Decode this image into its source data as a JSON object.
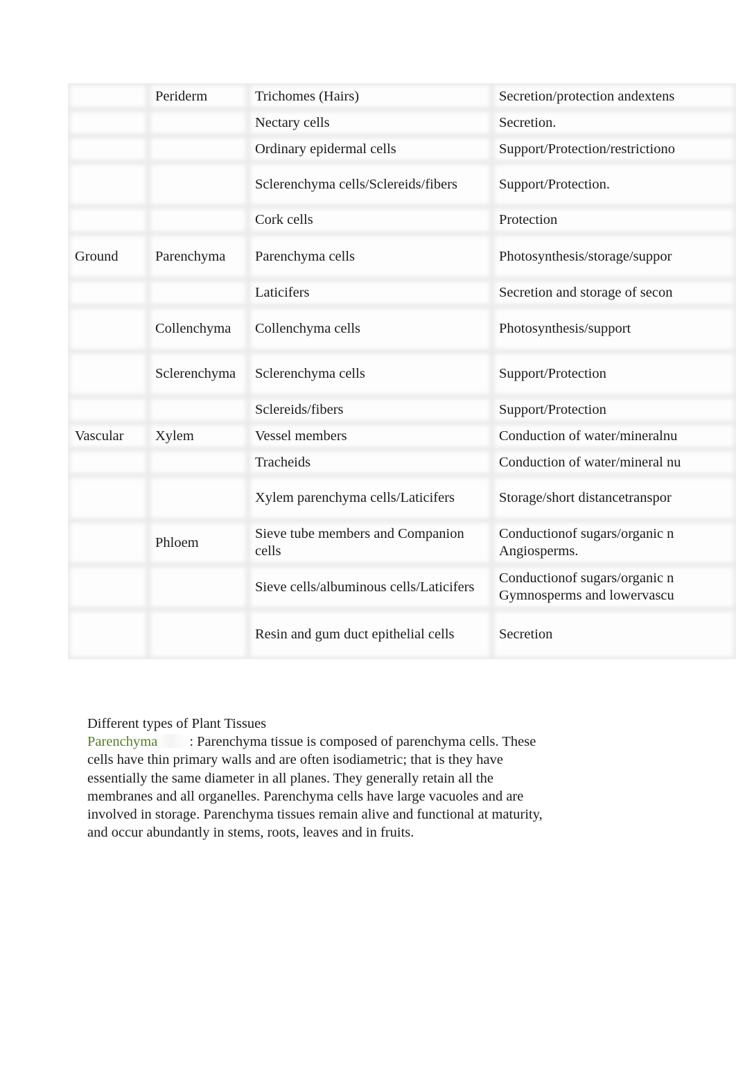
{
  "table": {
    "rows": [
      {
        "system": "",
        "tissue": "Periderm",
        "cell_type": "Trichomes (Hairs)",
        "function": "Secretion/protection andextens",
        "height": 38
      },
      {
        "system": "",
        "tissue": "",
        "cell_type": "Nectary cells",
        "function": "Secretion.",
        "height": 38
      },
      {
        "system": "",
        "tissue": "",
        "cell_type": "Ordinary epidermal cells",
        "function": "Support/Protection/restrictiono",
        "height": 38
      },
      {
        "system": "",
        "tissue": "",
        "cell_type": "Sclerenchyma cells/Sclereids/fibers",
        "function": "Support/Protection.",
        "height": 64
      },
      {
        "system": "",
        "tissue": "",
        "cell_type": "Cork cells",
        "function": "Protection",
        "height": 39
      },
      {
        "system": "Ground",
        "tissue": "Parenchyma",
        "cell_type": "Parenchyma cells",
        "function": "Photosynthesis/storage/suppor",
        "height": 66
      },
      {
        "system": "",
        "tissue": "",
        "cell_type": "Laticifers",
        "function": "Secretion and storage of secon",
        "height": 39
      },
      {
        "system": "",
        "tissue": "Collenchyma",
        "cell_type": "Collenchyma cells",
        "function": "Photosynthesis/support",
        "height": 65
      },
      {
        "system": "",
        "tissue": "Sclerenchyma",
        "cell_type": "Sclerenchyma cells",
        "function": "Support/Protection",
        "height": 65
      },
      {
        "system": "",
        "tissue": "",
        "cell_type": "Sclereids/fibers",
        "function": "Support/Protection",
        "height": 38
      },
      {
        "system": "Vascular",
        "tissue": "Xylem",
        "cell_type": "Vessel members",
        "function": "Conduction of water/mineralnu",
        "height": 38
      },
      {
        "system": "",
        "tissue": "",
        "cell_type": "Tracheids",
        "function": "Conduction of water/mineral nu",
        "height": 38
      },
      {
        "system": "",
        "tissue": "",
        "cell_type": "Xylem parenchyma cells/Laticifers",
        "function": "Storage/short distancetranspor",
        "height": 65
      },
      {
        "system": "",
        "tissue": "Phloem",
        "cell_type": "Sieve tube members and Companion cells",
        "function": "Conductionof sugars/organic n Angiosperms.",
        "height": 64
      },
      {
        "system": "",
        "tissue": "",
        "cell_type": "Sieve cells/albuminous cells/Laticifers",
        "function": "Conductionof sugars/organic n Gymnosperms and lowervascu",
        "height": 64
      },
      {
        "system": "",
        "tissue": "",
        "cell_type": "Resin and gum duct epithelial cells",
        "function": "Secretion",
        "height": 72
      }
    ]
  },
  "section": {
    "heading": "Different types of Plant Tissues",
    "term": "Parenchyma",
    "separator": ": ",
    "body": "Parenchyma tissue is composed of parenchyma cells. These cells have thin primary walls and are often isodiametric; that is they have essentially the same diameter in all planes. They generally retain all the membranes and all organelles. Parenchyma cells have large vacuoles and are involved in storage. Parenchyma tissues remain alive and functional at maturity, and occur abundantly in stems, roots, leaves and in fruits."
  },
  "colors": {
    "term_accent": "#557a2a",
    "grid": "#ececec"
  }
}
